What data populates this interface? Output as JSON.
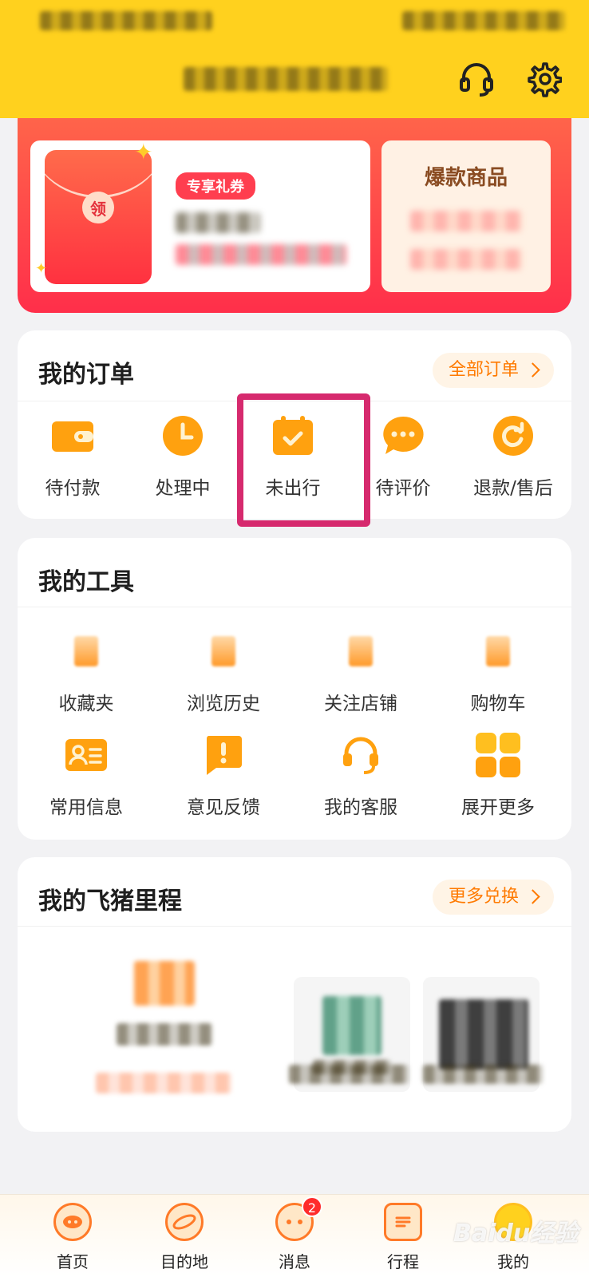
{
  "header": {
    "icons": [
      "headset-icon",
      "gear-icon"
    ]
  },
  "coupon": {
    "tag": "专享礼券",
    "seal": "领",
    "hot_title": "爆款商品"
  },
  "orders": {
    "title": "我的订单",
    "link": "全部订单",
    "items": [
      {
        "label": "待付款",
        "icon": "wallet-icon"
      },
      {
        "label": "处理中",
        "icon": "clock-icon"
      },
      {
        "label": "未出行",
        "icon": "calendar-check-icon"
      },
      {
        "label": "待评价",
        "icon": "chat-bubble-icon"
      },
      {
        "label": "退款/售后",
        "icon": "refund-icon"
      }
    ]
  },
  "tools": {
    "title": "我的工具",
    "items": [
      {
        "label": "收藏夹"
      },
      {
        "label": "浏览历史"
      },
      {
        "label": "关注店铺"
      },
      {
        "label": "购物车"
      },
      {
        "label": "常用信息",
        "icon": "id-card-icon"
      },
      {
        "label": "意见反馈",
        "icon": "feedback-icon"
      },
      {
        "label": "我的客服",
        "icon": "headset-icon"
      },
      {
        "label": "展开更多",
        "icon": "grid-icon"
      }
    ]
  },
  "mileage": {
    "title": "我的飞猪里程",
    "link": "更多兑换"
  },
  "nav": {
    "items": [
      {
        "label": "首页"
      },
      {
        "label": "目的地"
      },
      {
        "label": "消息",
        "badge": "2"
      },
      {
        "label": "行程"
      },
      {
        "label": "我的"
      }
    ]
  },
  "watermark": "Baidu经验",
  "colors": {
    "brand_yellow": "#ffd11e",
    "accent_orange": "#ff9a12",
    "highlight": "#d62a6e"
  }
}
